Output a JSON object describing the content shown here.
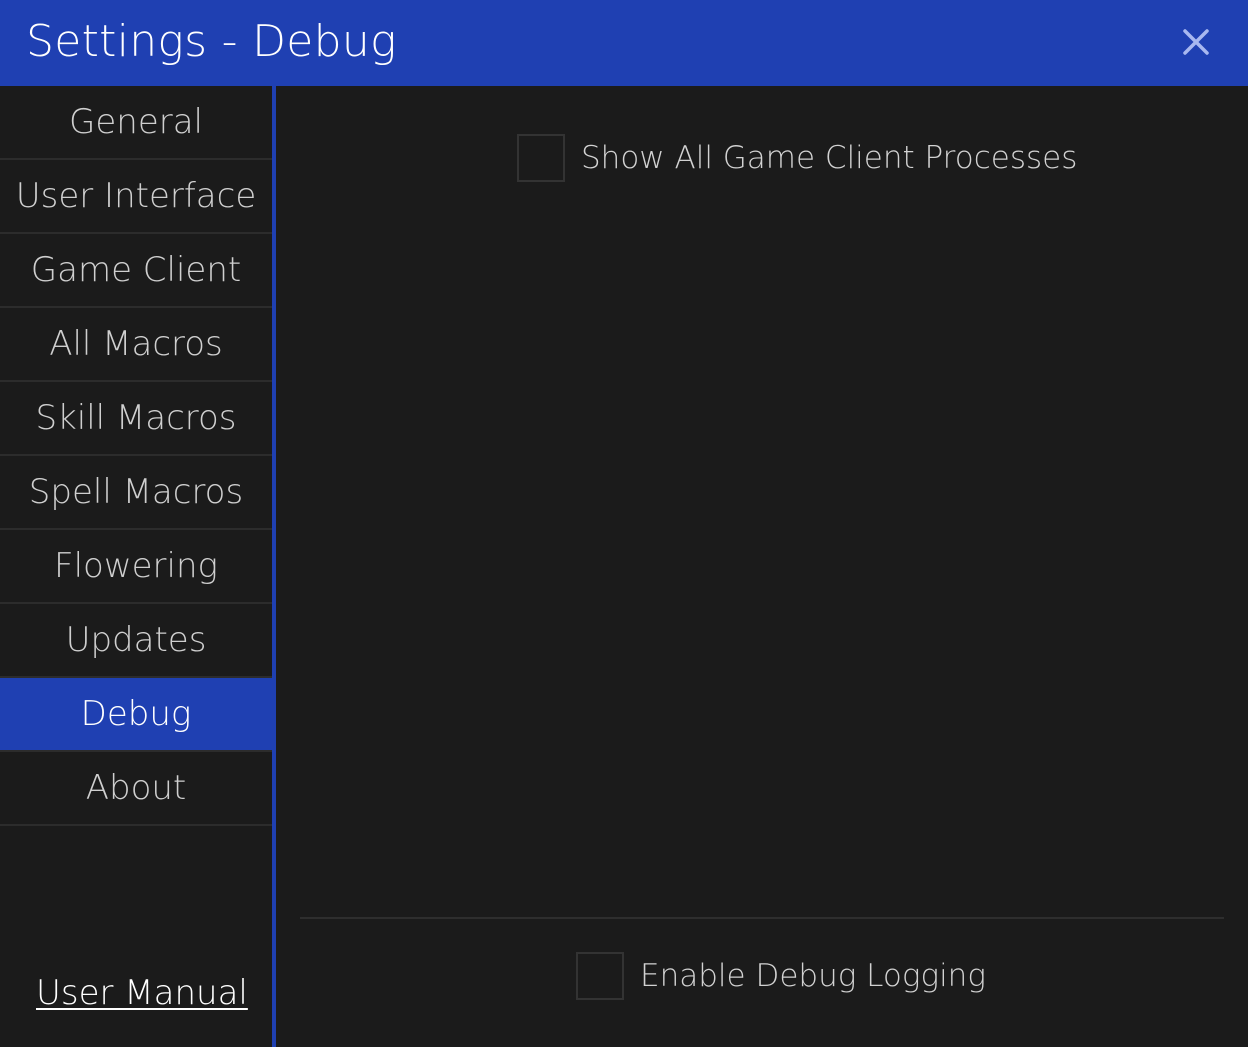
{
  "window": {
    "title": "Settings - Debug",
    "close_icon": "close-icon"
  },
  "colors": {
    "accent": "#1f40b2",
    "background": "#1b1b1b",
    "text": "#cfcfcf"
  },
  "sidebar": {
    "items": [
      {
        "label": "General",
        "active": false
      },
      {
        "label": "User Interface",
        "active": false
      },
      {
        "label": "Game Client",
        "active": false
      },
      {
        "label": "All Macros",
        "active": false
      },
      {
        "label": "Skill Macros",
        "active": false
      },
      {
        "label": "Spell Macros",
        "active": false
      },
      {
        "label": "Flowering",
        "active": false
      },
      {
        "label": "Updates",
        "active": false
      },
      {
        "label": "Debug",
        "active": true
      },
      {
        "label": "About",
        "active": false
      }
    ],
    "user_manual_label": "User Manual"
  },
  "main": {
    "options": [
      {
        "label": "Show All Game Client Processes",
        "checked": false
      },
      {
        "label": "Enable Debug Logging",
        "checked": false
      }
    ]
  }
}
